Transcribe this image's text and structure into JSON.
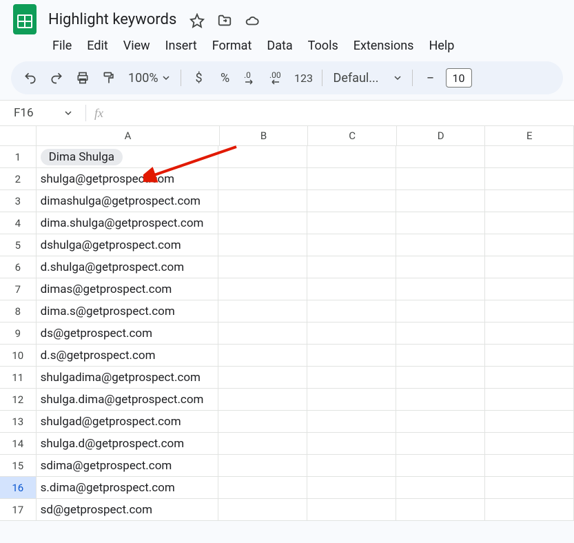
{
  "header": {
    "doc_title": "Highlight keywords",
    "menus": [
      "File",
      "Edit",
      "View",
      "Insert",
      "Format",
      "Data",
      "Tools",
      "Extensions",
      "Help"
    ]
  },
  "toolbar": {
    "zoom": "100%",
    "font_name": "Defaul...",
    "font_size": "10"
  },
  "formula_bar": {
    "name_box": "F16",
    "fx_label": "fx"
  },
  "grid": {
    "columns": [
      "A",
      "B",
      "C",
      "D",
      "E"
    ],
    "rows": [
      {
        "n": "1",
        "A_chip": "Dima Shulga"
      },
      {
        "n": "2",
        "A": "shulga@getprospect.com"
      },
      {
        "n": "3",
        "A": "dimashulga@getprospect.com"
      },
      {
        "n": "4",
        "A": "dima.shulga@getprospect.com"
      },
      {
        "n": "5",
        "A": "dshulga@getprospect.com"
      },
      {
        "n": "6",
        "A": "d.shulga@getprospect.com"
      },
      {
        "n": "7",
        "A": "dimas@getprospect.com"
      },
      {
        "n": "8",
        "A": "dima.s@getprospect.com"
      },
      {
        "n": "9",
        "A": "ds@getprospect.com"
      },
      {
        "n": "10",
        "A": "d.s@getprospect.com"
      },
      {
        "n": "11",
        "A": "shulgadima@getprospect.com"
      },
      {
        "n": "12",
        "A": "shulga.dima@getprospect.com"
      },
      {
        "n": "13",
        "A": "shulgad@getprospect.com"
      },
      {
        "n": "14",
        "A": "shulga.d@getprospect.com"
      },
      {
        "n": "15",
        "A": "sdima@getprospect.com"
      },
      {
        "n": "16",
        "A": "s.dima@getprospect.com",
        "selected": true
      },
      {
        "n": "17",
        "A": "sd@getprospect.com"
      }
    ]
  }
}
